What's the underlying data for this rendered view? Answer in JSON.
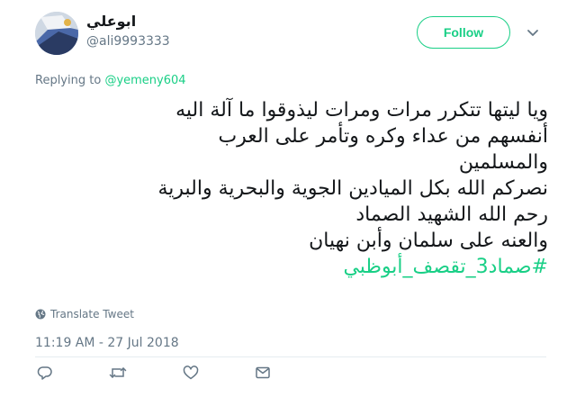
{
  "user": {
    "display_name": "ابوعلي",
    "handle": "@ali9993333"
  },
  "follow_label": "Follow",
  "reply": {
    "prefix": "Replying to ",
    "mention": "@yemeny604"
  },
  "tweet": {
    "lines": [
      "ويا ليتها تتكرر مرات ومرات ليذوقوا ما آلة اليه",
      "أنفسهم من عداء وكره وتأمر على العرب",
      "والمسلمين",
      "نصركم الله بكل الميادين الجوية والبحرية والبرية",
      "رحم الله الشهيد الصماد",
      "والعنه على سلمان وأبن نهيان"
    ],
    "hashtag": "#صماد3_تقصف_أبوظبي"
  },
  "translate_label": "Translate Tweet",
  "timestamp": "11:19 AM - 27 Jul 2018",
  "actions": {
    "icons": [
      "reply-icon",
      "retweet-icon",
      "like-icon",
      "direct-message-icon"
    ]
  },
  "colors": {
    "accent": "#19cf86",
    "muted": "#657786",
    "text": "#14171a",
    "divider": "#e6ecf0"
  }
}
